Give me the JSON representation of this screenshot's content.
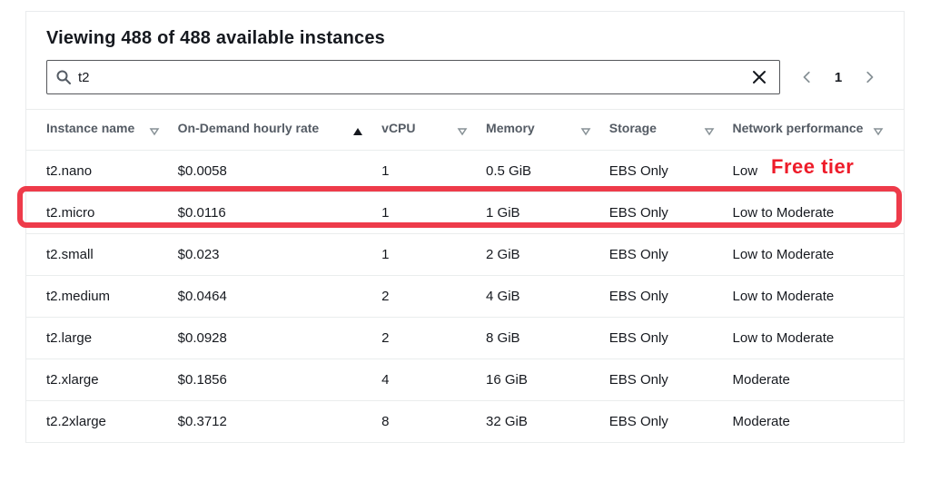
{
  "header": {
    "title": "Viewing 488 of 488 available instances"
  },
  "search": {
    "value": "t2",
    "placeholder": ""
  },
  "pager": {
    "current": "1"
  },
  "annotation": {
    "free_tier": "Free tier"
  },
  "columns": {
    "name": "Instance name",
    "rate": "On-Demand hourly rate",
    "vcpu": "vCPU",
    "memory": "Memory",
    "storage": "Storage",
    "network": "Network performance"
  },
  "sort": {
    "column": "rate",
    "direction": "asc"
  },
  "rows": [
    {
      "name": "t2.nano",
      "rate": "$0.0058",
      "vcpu": "1",
      "memory": "0.5 GiB",
      "storage": "EBS Only",
      "network": "Low",
      "highlighted": false
    },
    {
      "name": "t2.micro",
      "rate": "$0.0116",
      "vcpu": "1",
      "memory": "1 GiB",
      "storage": "EBS Only",
      "network": "Low to Moderate",
      "highlighted": true
    },
    {
      "name": "t2.small",
      "rate": "$0.023",
      "vcpu": "1",
      "memory": "2 GiB",
      "storage": "EBS Only",
      "network": "Low to Moderate",
      "highlighted": false
    },
    {
      "name": "t2.medium",
      "rate": "$0.0464",
      "vcpu": "2",
      "memory": "4 GiB",
      "storage": "EBS Only",
      "network": "Low to Moderate",
      "highlighted": false
    },
    {
      "name": "t2.large",
      "rate": "$0.0928",
      "vcpu": "2",
      "memory": "8 GiB",
      "storage": "EBS Only",
      "network": "Low to Moderate",
      "highlighted": false
    },
    {
      "name": "t2.xlarge",
      "rate": "$0.1856",
      "vcpu": "4",
      "memory": "16 GiB",
      "storage": "EBS Only",
      "network": "Moderate",
      "highlighted": false
    },
    {
      "name": "t2.2xlarge",
      "rate": "$0.3712",
      "vcpu": "8",
      "memory": "32 GiB",
      "storage": "EBS Only",
      "network": "Moderate",
      "highlighted": false
    }
  ]
}
